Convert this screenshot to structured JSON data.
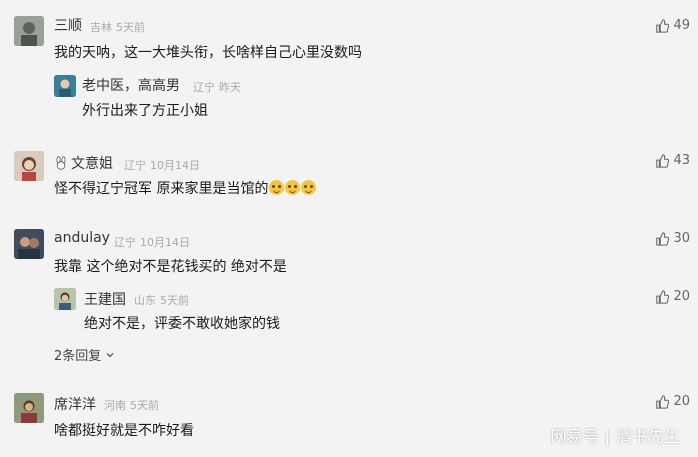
{
  "comments": [
    {
      "name": "三顺",
      "location": "吉林",
      "time": "5天前",
      "text": "我的天呐，这一大堆头衔，长啥样自己心里没数吗",
      "likes": "49",
      "avatar_color": "#8a8f88",
      "replies": [
        {
          "name": "老中医，高高男",
          "location": "辽宁",
          "time": "昨天",
          "text": "外行出来了方正小姐",
          "avatar_color": "#3b7e95"
        }
      ]
    },
    {
      "name": "文意姐",
      "location": "辽宁",
      "time": "10月14日",
      "text": "怪不得辽宁冠军 原来家里是当馆的",
      "likes": "43",
      "avatar_color": "#b07a5a"
    },
    {
      "name": "andulay",
      "location": "辽宁",
      "time": "10月14日",
      "text": "我靠 这个绝对不是花钱买的 绝对不是",
      "likes": "30",
      "avatar_color": "#4b5a6a",
      "replies": [
        {
          "name": "王建国",
          "location": "山东",
          "time": "5天前",
          "text": "绝对不是，评委不敢收她家的钱",
          "likes": "20",
          "avatar_color": "#6a7a50"
        }
      ],
      "more_label": "2条回复"
    },
    {
      "name": "席洋洋",
      "location": "河南",
      "time": "5天前",
      "text": "啥都挺好就是不咋好看",
      "likes": "20",
      "avatar_color": "#7a6a55"
    }
  ],
  "watermark": {
    "brand": "网易号",
    "author": "清书先生"
  }
}
